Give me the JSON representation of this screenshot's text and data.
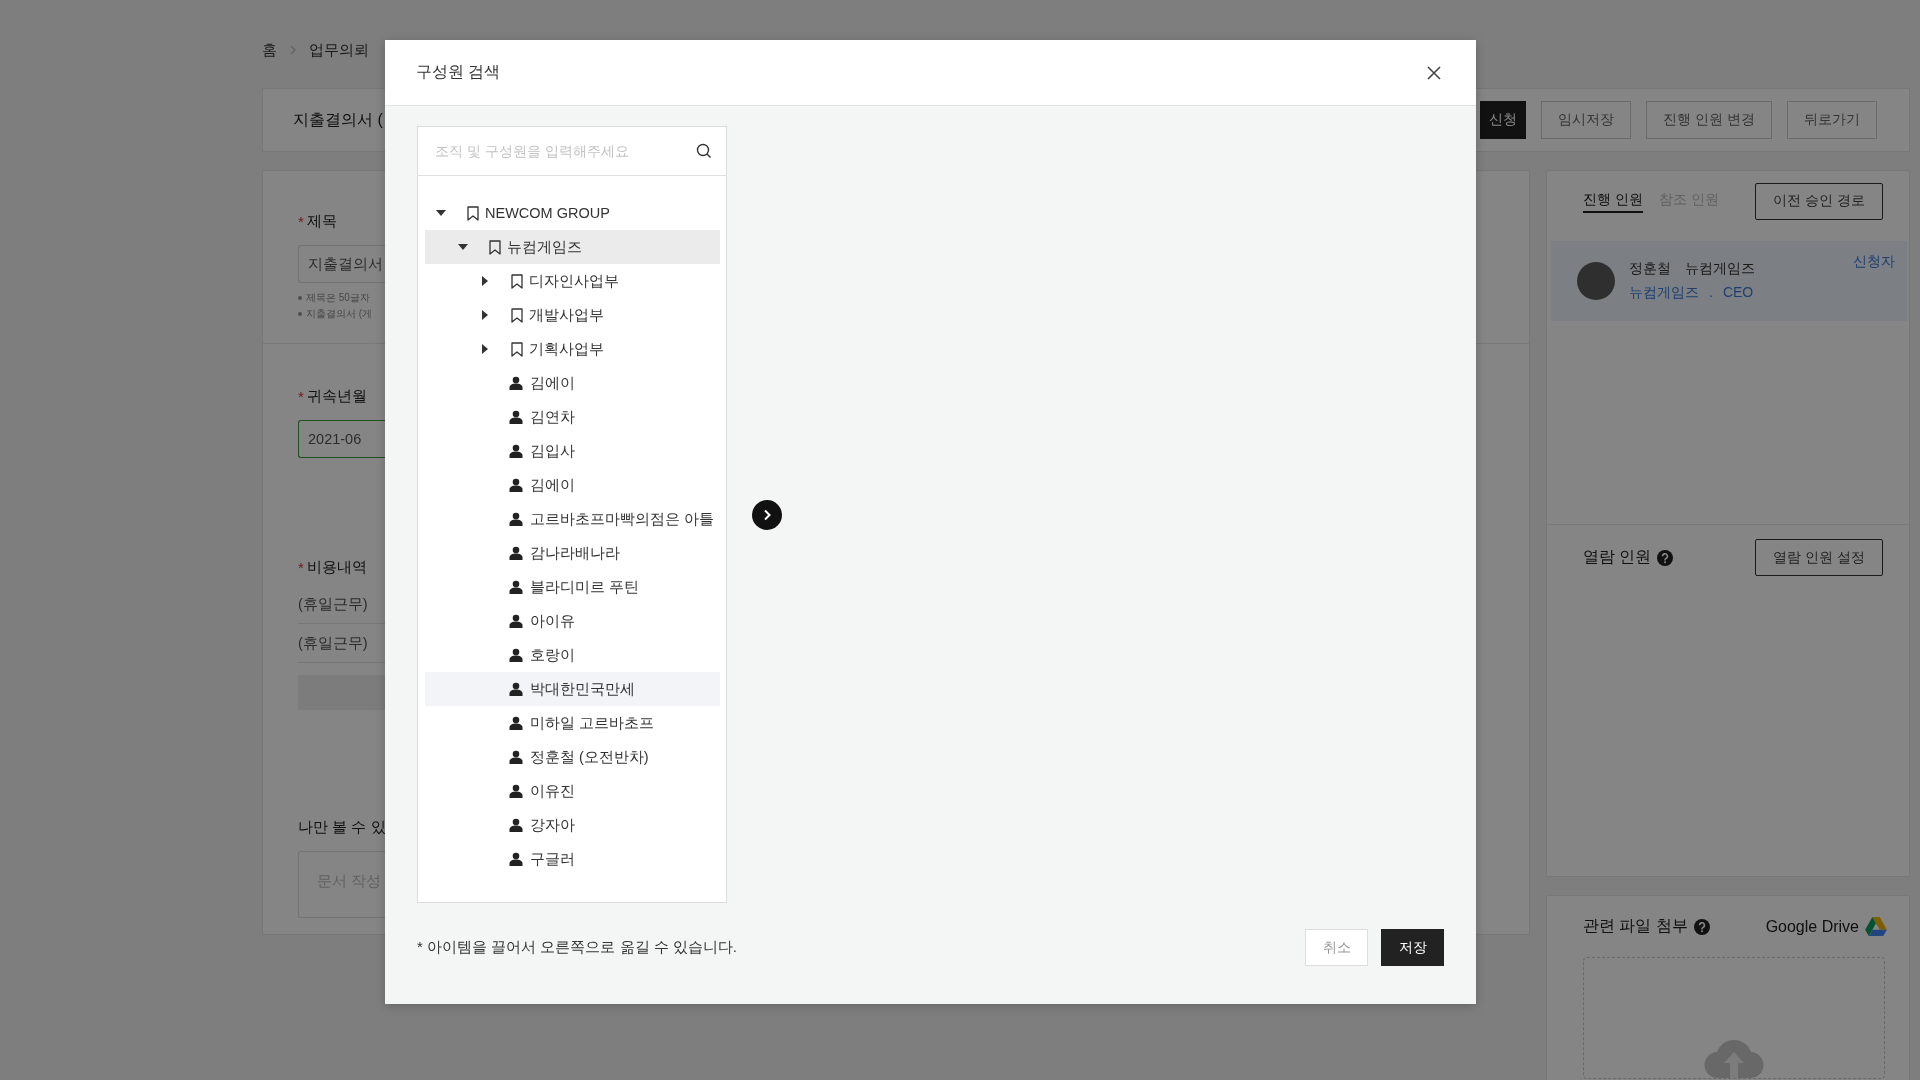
{
  "breadcrumb": [
    {
      "label": "홈"
    },
    {
      "label": "업무의뢰"
    }
  ],
  "header": {
    "title": "지출결의서 (",
    "buttons": [
      {
        "label": "신청",
        "kind": "primary"
      },
      {
        "label": "임시저장",
        "kind": "outline"
      },
      {
        "label": "진행 인원 변경",
        "kind": "outline"
      },
      {
        "label": "뒤로가기",
        "kind": "outline"
      }
    ]
  },
  "form": {
    "title_field": {
      "mark": "*",
      "label": "제목",
      "value": "지출결의서",
      "hints": [
        "제목은 50글자",
        "지출결의서 (게"
      ]
    },
    "period_field": {
      "mark": "*",
      "label": "귀속년월",
      "value": "2021-06",
      "focused": true
    },
    "expenses": {
      "mark": "*",
      "label": "비용내역",
      "rows": [
        "(휴일근무)",
        "(휴일근무)"
      ]
    },
    "memo": {
      "label": "나만 볼 수 있",
      "placeholder": "문서 작성"
    }
  },
  "approval": {
    "tabs": [
      {
        "label": "진행 인원",
        "selected": true
      },
      {
        "label": "참조 인원",
        "selected": false
      }
    ],
    "history_button": "이전 승인 경로",
    "people": [
      {
        "name": "정훈철",
        "company": "뉴컴게임즈",
        "department": "뉴컴게임즈",
        "separator": ".",
        "position": "CEO",
        "role": "신청자"
      }
    ]
  },
  "viewers": {
    "title": "열람 인원",
    "button": "열람 인원 설정"
  },
  "attachments": {
    "title": "관련 파일 첨부",
    "drive_label": "Google Drive"
  },
  "modal": {
    "title": "구성원 검색",
    "search": {
      "placeholder": "조직 및 구성원을 입력해주세요"
    },
    "tree": [
      {
        "kind": "group",
        "label": "NEWCOM GROUP",
        "expanded": true,
        "selected": false,
        "hovered": false,
        "children": [
          {
            "kind": "group",
            "label": "뉴컴게임즈",
            "expanded": true,
            "selected": true,
            "hovered": false,
            "children": [
              {
                "kind": "group",
                "label": "디자인사업부",
                "expanded": false,
                "selected": false,
                "hovered": false
              },
              {
                "kind": "group",
                "label": "개발사업부",
                "expanded": false,
                "selected": false,
                "hovered": false
              },
              {
                "kind": "group",
                "label": "기획사업부",
                "expanded": false,
                "selected": false,
                "hovered": false
              },
              {
                "kind": "person",
                "label": "김에이",
                "selected": false,
                "hovered": false
              },
              {
                "kind": "person",
                "label": "김연차",
                "selected": false,
                "hovered": false
              },
              {
                "kind": "person",
                "label": "김입사",
                "selected": false,
                "hovered": false
              },
              {
                "kind": "person",
                "label": "김에이",
                "selected": false,
                "hovered": false
              },
              {
                "kind": "person",
                "label": "고르바초프마빡의점은 아틀",
                "selected": false,
                "hovered": false
              },
              {
                "kind": "person",
                "label": "감나라배나라",
                "selected": false,
                "hovered": false
              },
              {
                "kind": "person",
                "label": "블라디미르 푸틴",
                "selected": false,
                "hovered": false
              },
              {
                "kind": "person",
                "label": "아이유",
                "selected": false,
                "hovered": false
              },
              {
                "kind": "person",
                "label": "호랑이",
                "selected": false,
                "hovered": false
              },
              {
                "kind": "person",
                "label": "박대한민국만세",
                "selected": false,
                "hovered": true
              },
              {
                "kind": "person",
                "label": "미하일 고르바초프",
                "selected": false,
                "hovered": false
              },
              {
                "kind": "person",
                "label": "정훈철 (오전반차)",
                "selected": false,
                "hovered": false
              },
              {
                "kind": "person",
                "label": "이유진",
                "selected": false,
                "hovered": false
              },
              {
                "kind": "person",
                "label": "강자아",
                "selected": false,
                "hovered": false
              },
              {
                "kind": "person",
                "label": "구글러",
                "selected": false,
                "hovered": false
              }
            ]
          }
        ]
      }
    ],
    "note": "* 아이템을 끌어서 오른쪽으로 옮길 수 있습니다.",
    "buttons": [
      {
        "label": "취소",
        "kind": "secondary"
      },
      {
        "label": "저장",
        "kind": "primary"
      }
    ]
  }
}
